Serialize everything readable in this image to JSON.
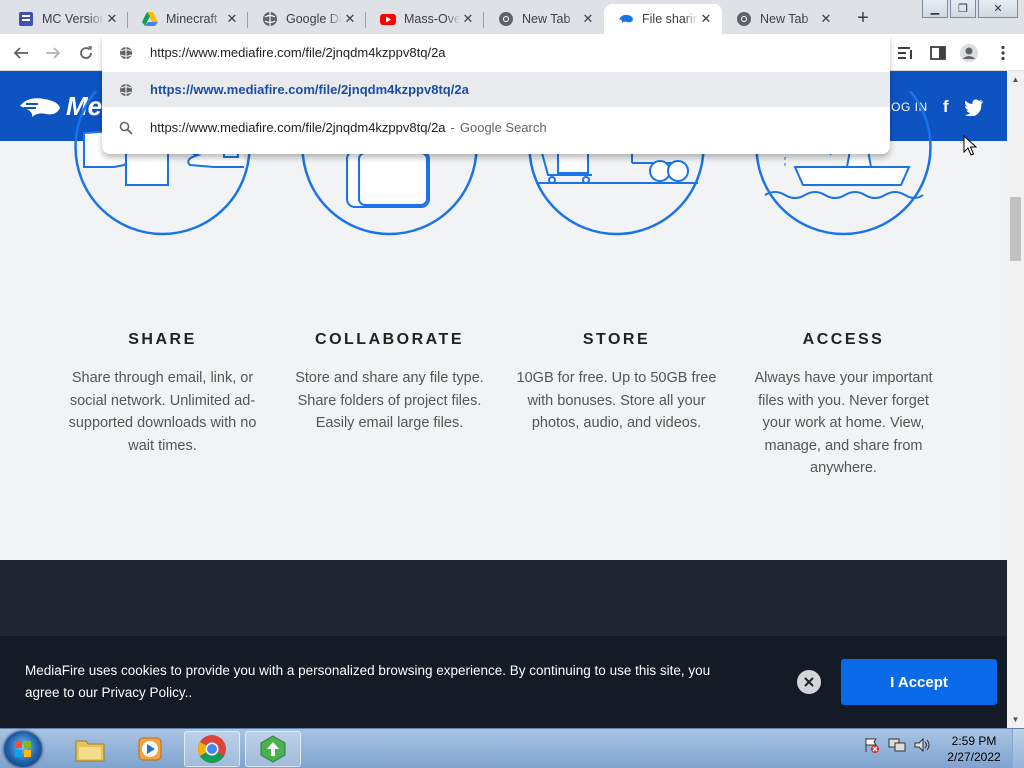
{
  "browser": {
    "tabs": [
      {
        "title": "MC Version",
        "icon": "forms-icon"
      },
      {
        "title": "Minecraft",
        "icon": "google-drive-icon"
      },
      {
        "title": "Google Di",
        "icon": "globe-icon"
      },
      {
        "title": "Mass-Ove",
        "icon": "youtube-icon"
      },
      {
        "title": "New Tab",
        "icon": "chrome-icon"
      },
      {
        "title": "File sharin",
        "icon": "mediafire-icon",
        "active": true
      },
      {
        "title": "New Tab",
        "icon": "chrome-icon"
      }
    ],
    "omnibox": {
      "current_text": "https://www.mediafire.com/file/2jnqdm4kzppv8tq/2a",
      "suggestions": [
        {
          "text": "https://www.mediafire.com/file/2jnqdm4kzppv8tq/2a",
          "icon": "globe-icon",
          "selected": true
        },
        {
          "text": "https://www.mediafire.com/file/2jnqdm4kzppv8tq/2a",
          "hint": "Google Search",
          "dash": "-",
          "icon": "search-icon"
        }
      ]
    }
  },
  "site": {
    "logo_text": "Me",
    "login_label": "LOG IN",
    "accent_color": "#0d53c1",
    "features": [
      {
        "title": "SHARE",
        "text": "Share through email, link, or social network. Unlimited ad-supported downloads with no wait times."
      },
      {
        "title": "COLLABORATE",
        "text": "Store and share any file type. Share folders of project files. Easily email large files."
      },
      {
        "title": "STORE",
        "text": "10GB for free. Up to 50GB free with bonuses. Store all your photos, audio, and videos."
      },
      {
        "title": "ACCESS",
        "text": "Always have your important files with you. Never forget your work at home. View, manage, and share from anywhere."
      }
    ],
    "cookie": {
      "text": "MediaFire uses cookies to provide you with a personalized browsing experience. By continuing to use this site, you agree to our Privacy Policy..",
      "accept_label": "I Accept"
    }
  },
  "taskbar": {
    "time": "2:59 PM",
    "date": "2/27/2022"
  }
}
